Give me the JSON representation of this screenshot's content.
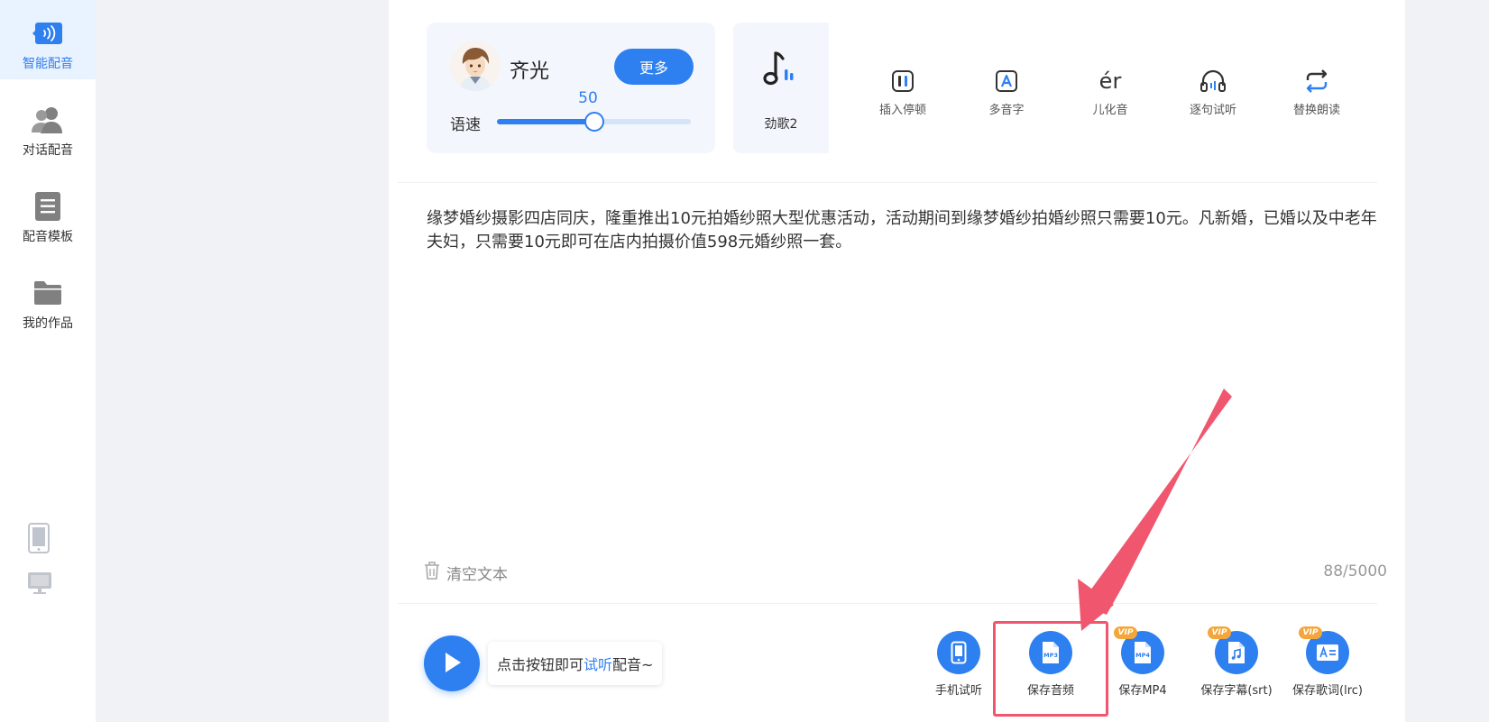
{
  "sidebar": {
    "items": [
      {
        "label": "智能配音",
        "icon": "smart-dubbing-icon",
        "active": true
      },
      {
        "label": "对话配音",
        "icon": "dialogue-users-icon",
        "active": false
      },
      {
        "label": "配音模板",
        "icon": "template-doc-icon",
        "active": false
      },
      {
        "label": "我的作品",
        "icon": "folder-icon",
        "active": false
      }
    ],
    "devices": [
      "mobile-device-icon",
      "desktop-device-icon"
    ]
  },
  "voice": {
    "name": "齐光",
    "more_label": "更多",
    "speed_label": "语速",
    "speed_value": "50",
    "speed_fraction": 0.5
  },
  "bgm": {
    "label": "劲歌2",
    "icon": "music-note-icon"
  },
  "tools": [
    {
      "label": "插入停顿",
      "icon": "pause-insert-icon"
    },
    {
      "label": "多音字",
      "icon": "polyphone-a-icon"
    },
    {
      "label": "儿化音",
      "icon": "er-pinyin-icon",
      "glyph": "ér"
    },
    {
      "label": "逐句试听",
      "icon": "headphones-icon"
    },
    {
      "label": "替换朗读",
      "icon": "replace-loop-icon"
    }
  ],
  "editor": {
    "text": "缘梦婚纱摄影四店同庆，隆重推出10元拍婚纱照大型优惠活动，活动期间到缘梦婚纱拍婚纱照只需要10元。凡新婚，已婚以及中老年夫妇，只需要10元即可在店内拍摄价值598元婚纱照一套。",
    "clear_label": "清空文本",
    "char_count": "88/5000"
  },
  "player": {
    "hint_before": "点击按钮即可",
    "hint_link": "试听",
    "hint_after": "配音~"
  },
  "actions": [
    {
      "label": "手机试听",
      "icon": "phone-preview-icon",
      "vip": false
    },
    {
      "label": "保存音频",
      "icon": "mp3-file-icon",
      "vip": false,
      "badge": "MP3"
    },
    {
      "label": "保存MP4",
      "icon": "mp4-file-icon",
      "vip": true,
      "badge": "MP4"
    },
    {
      "label": "保存字幕(srt)",
      "icon": "subtitle-music-icon",
      "vip": true
    },
    {
      "label": "保存歌词(lrc)",
      "icon": "lyrics-a-icon",
      "vip": true
    }
  ],
  "vip_text": "VIP",
  "colors": {
    "accent": "#2e80f0",
    "vip": "#f4a63a",
    "annotation": "#f0576e"
  }
}
